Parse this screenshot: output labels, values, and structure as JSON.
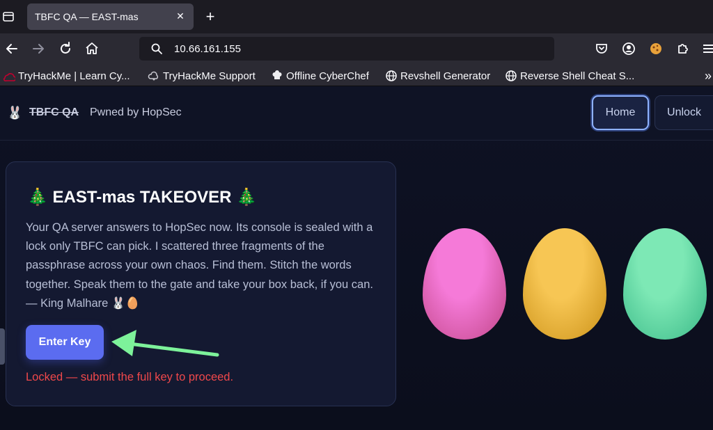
{
  "browser": {
    "tab_title": "TBFC QA — EAST-mas",
    "url": "10.66.161.155",
    "bookmarks": [
      {
        "label": "TryHackMe | Learn Cy...",
        "icon": "tryhackme-icon"
      },
      {
        "label": "TryHackMe Support",
        "icon": "cloud-icon"
      },
      {
        "label": "Offline CyberChef",
        "icon": "chef-hat-icon"
      },
      {
        "label": "Revshell Generator",
        "icon": "globe-icon"
      },
      {
        "label": "Reverse Shell Cheat S...",
        "icon": "globe-icon"
      }
    ],
    "bookmarks_overflow": "»"
  },
  "site": {
    "brand_icon": "🐰",
    "brand_name": "TBFC QA",
    "brand_tagline": "Pwned by HopSec",
    "nav": [
      {
        "label": "Home",
        "active": true
      },
      {
        "label": "Unlock",
        "active": false
      }
    ]
  },
  "card": {
    "title": "🎄 EAST-mas TAKEOVER 🎄",
    "body": "Your QA server answers to HopSec now. Its console is sealed with a lock only TBFC can pick. I scattered three fragments of the passphrase across your own chaos. Find them. Stitch the words together. Speak them to the gate and take your box back, if you can. — King Malhare 🐰🥚",
    "button_label": "Enter Key",
    "status": "Locked — submit the full key to proceed."
  },
  "eggs": [
    {
      "color_light": "#f57ad8",
      "color_dark": "#d0559f"
    },
    {
      "color_light": "#f7c654",
      "color_dark": "#d8a12a"
    },
    {
      "color_light": "#7de8b5",
      "color_dark": "#4ec795"
    }
  ],
  "colors": {
    "accent": "#5b6cf0",
    "error": "#f0484b",
    "arrow": "#7df29a"
  }
}
